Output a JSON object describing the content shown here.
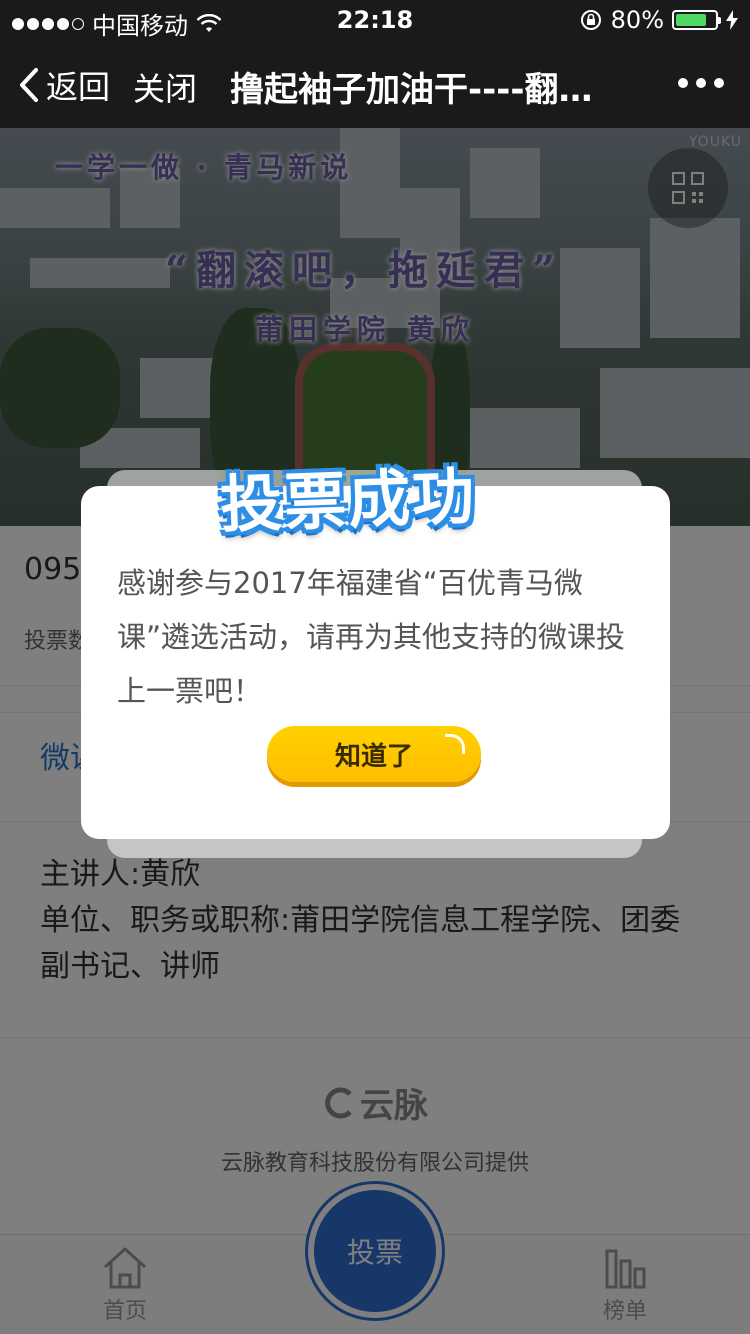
{
  "status_bar": {
    "carrier": "中国移动",
    "time": "22:18",
    "battery_percent": "80%",
    "battery_level": 0.8
  },
  "nav": {
    "back_label": "返回",
    "close_label": "关闭",
    "title": "撸起袖子加油干----翻…"
  },
  "video": {
    "line1": "一学一做 · 青马新说",
    "line2": "“翻滚吧，拖延君”",
    "line3": "莆田学院  黄欣",
    "watermark": "YOUKU"
  },
  "content": {
    "id_number": "095",
    "votes_label": "投票数",
    "tab_label": "微课",
    "speaker": "主讲人:黄欣",
    "unit": "单位、职务或职称:莆田学院信息工程学院、团委副书记、讲师",
    "brand_name": "云脉",
    "brand_text": "云脉教育科技股份有限公司提供"
  },
  "tabbar": {
    "home_label": "首页",
    "vote_label": "投票",
    "rank_label": "榜单"
  },
  "modal": {
    "title": "投票成功",
    "message": "感谢参与2017年福建省“百优青马微课”遴选活动，请再为其他支持的微课投上一票吧！",
    "button_label": "知道了"
  }
}
